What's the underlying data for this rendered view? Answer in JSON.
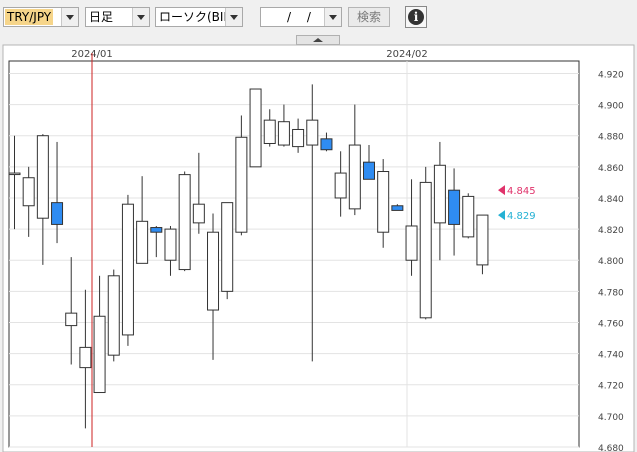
{
  "toolbar": {
    "pair": "TRY/JPY",
    "period": "日足",
    "chart_type": "ローソク(BID)",
    "date_value": "/ /",
    "search_label": "検索",
    "info_symbol": "i"
  },
  "colors": {
    "pair_highlight": "#f6d58a",
    "up_candle": "#ffffff",
    "down_candle": "#2f8cf2",
    "vline": "#cc2222",
    "ask_marker": "#e0336b",
    "bid_marker": "#25b1d4"
  },
  "price_markers": [
    {
      "label": "4.845",
      "value": 4.845,
      "color": "#e0336b"
    },
    {
      "label": "4.829",
      "value": 4.829,
      "color": "#25b1d4"
    }
  ],
  "chart_data": {
    "type": "candlestick",
    "x_labels": [
      "2024/01",
      "2024/02"
    ],
    "y_ticks": [
      "4.920",
      "4.900",
      "4.880",
      "4.860",
      "4.840",
      "4.820",
      "4.800",
      "4.780",
      "4.760",
      "4.740",
      "4.720",
      "4.700",
      "4.680"
    ],
    "ylim": [
      4.68,
      4.928
    ],
    "grid": true,
    "candles": [
      {
        "o": 4.856,
        "h": 4.88,
        "l": 4.82,
        "c": 4.856
      },
      {
        "o": 4.835,
        "h": 4.86,
        "l": 4.815,
        "c": 4.853
      },
      {
        "o": 4.827,
        "h": 4.881,
        "l": 4.797,
        "c": 4.88
      },
      {
        "o": 4.837,
        "h": 4.876,
        "l": 4.811,
        "c": 4.823
      },
      {
        "o": 4.758,
        "h": 4.802,
        "l": 4.733,
        "c": 4.766
      },
      {
        "o": 4.731,
        "h": 4.781,
        "l": 4.692,
        "c": 4.744
      },
      {
        "o": 4.715,
        "h": 4.79,
        "l": 4.715,
        "c": 4.764
      },
      {
        "o": 4.739,
        "h": 4.794,
        "l": 4.735,
        "c": 4.79
      },
      {
        "o": 4.752,
        "h": 4.842,
        "l": 4.745,
        "c": 4.836
      },
      {
        "o": 4.798,
        "h": 4.854,
        "l": 4.798,
        "c": 4.825
      },
      {
        "o": 4.821,
        "h": 4.822,
        "l": 4.802,
        "c": 4.818
      },
      {
        "o": 4.8,
        "h": 4.822,
        "l": 4.79,
        "c": 4.82
      },
      {
        "o": 4.794,
        "h": 4.857,
        "l": 4.793,
        "c": 4.855
      },
      {
        "o": 4.824,
        "h": 4.869,
        "l": 4.817,
        "c": 4.836
      },
      {
        "o": 4.768,
        "h": 4.83,
        "l": 4.736,
        "c": 4.818
      },
      {
        "o": 4.78,
        "h": 4.836,
        "l": 4.775,
        "c": 4.837
      },
      {
        "o": 4.818,
        "h": 4.893,
        "l": 4.816,
        "c": 4.879
      },
      {
        "o": 4.86,
        "h": 4.91,
        "l": 4.86,
        "c": 4.91
      },
      {
        "o": 4.875,
        "h": 4.897,
        "l": 4.873,
        "c": 4.89
      },
      {
        "o": 4.874,
        "h": 4.9,
        "l": 4.873,
        "c": 4.889
      },
      {
        "o": 4.873,
        "h": 4.891,
        "l": 4.869,
        "c": 4.884
      },
      {
        "o": 4.874,
        "h": 4.913,
        "l": 4.735,
        "c": 4.89
      },
      {
        "o": 4.878,
        "h": 4.882,
        "l": 4.87,
        "c": 4.871
      },
      {
        "o": 4.84,
        "h": 4.87,
        "l": 4.828,
        "c": 4.856
      },
      {
        "o": 4.833,
        "h": 4.9,
        "l": 4.829,
        "c": 4.874
      },
      {
        "o": 4.863,
        "h": 4.874,
        "l": 4.852,
        "c": 4.852
      },
      {
        "o": 4.818,
        "h": 4.865,
        "l": 4.808,
        "c": 4.857
      },
      {
        "o": 4.835,
        "h": 4.836,
        "l": 4.834,
        "c": 4.832
      },
      {
        "o": 4.8,
        "h": 4.852,
        "l": 4.79,
        "c": 4.822
      },
      {
        "o": 4.763,
        "h": 4.86,
        "l": 4.762,
        "c": 4.85
      },
      {
        "o": 4.824,
        "h": 4.876,
        "l": 4.8,
        "c": 4.861
      },
      {
        "o": 4.845,
        "h": 4.859,
        "l": 4.803,
        "c": 4.823
      },
      {
        "o": 4.815,
        "h": 4.843,
        "l": 4.814,
        "c": 4.841
      },
      {
        "o": 4.797,
        "h": 4.829,
        "l": 4.791,
        "c": 4.829
      }
    ]
  }
}
